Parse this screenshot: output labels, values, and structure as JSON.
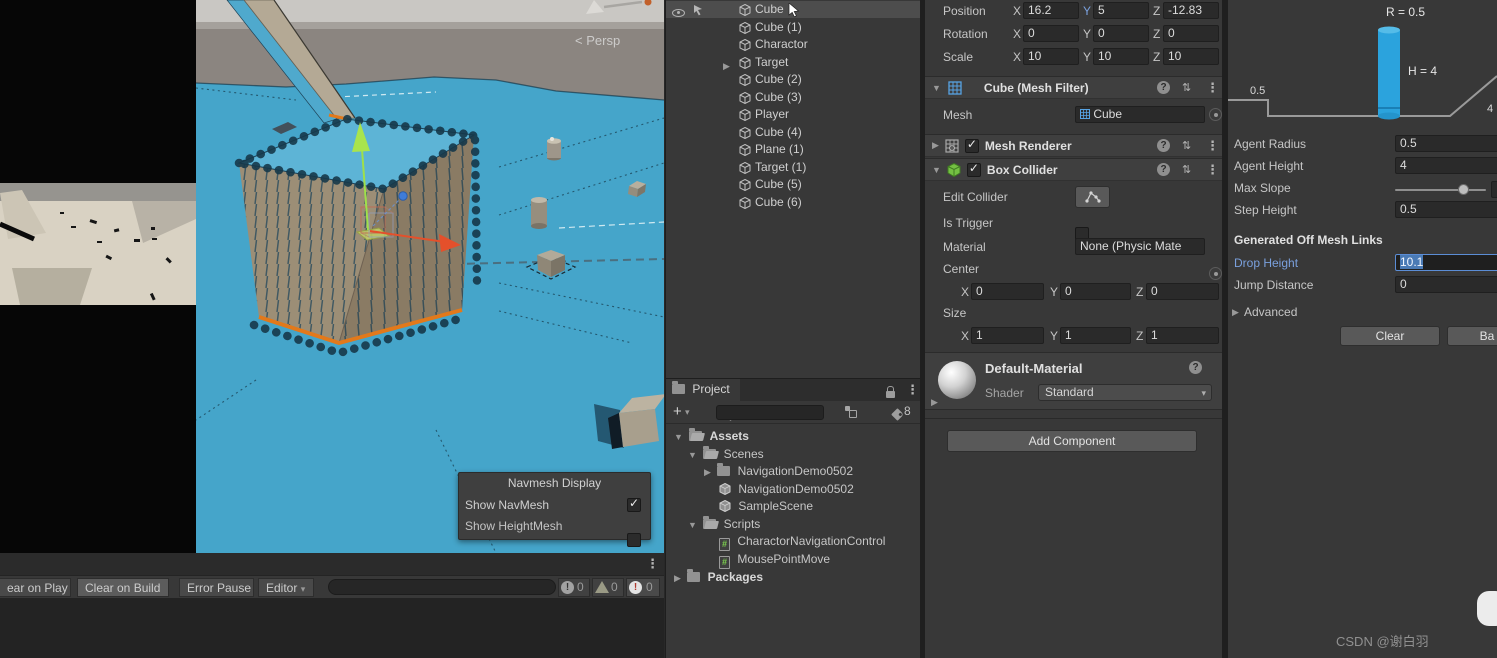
{
  "glyphs": {
    "fold_open": "▼",
    "fold_closed": "▶",
    "kebab": "⋮",
    "preset": "⇅",
    "caret_down": "▾",
    "plus": "+",
    "help": "?",
    "check": "✓",
    "bang": "!",
    "hash": "#",
    "lt": "<"
  },
  "scene": {
    "persp_label": "Persp",
    "navmesh_overlay": {
      "title": "Navmesh Display",
      "items": [
        {
          "label": "Show NavMesh",
          "checked": true
        },
        {
          "label": "Show HeightMesh",
          "checked": false
        }
      ]
    }
  },
  "hierarchy": {
    "items": [
      {
        "label": "Cube"
      },
      {
        "label": "Cube (1)"
      },
      {
        "label": "Charactor"
      },
      {
        "label": "Target"
      },
      {
        "label": "Cube (2)"
      },
      {
        "label": "Cube (3)"
      },
      {
        "label": "Player"
      },
      {
        "label": "Cube (4)"
      },
      {
        "label": "Plane (1)"
      },
      {
        "label": "Target (1)"
      },
      {
        "label": "Cube (5)"
      },
      {
        "label": "Cube (6)"
      }
    ]
  },
  "project": {
    "tab": "Project",
    "search_placeholder": "",
    "hidden_count": "8",
    "tree": [
      {
        "label": "Assets"
      },
      {
        "label": "Scenes"
      },
      {
        "label": "NavigationDemo0502"
      },
      {
        "label": "NavigationDemo0502"
      },
      {
        "label": "SampleScene"
      },
      {
        "label": "Scripts"
      },
      {
        "label": "CharactorNavigationControl"
      },
      {
        "label": "MousePointMove"
      },
      {
        "label": "Packages"
      }
    ]
  },
  "inspector": {
    "axes": {
      "x": "X",
      "y": "Y",
      "z": "Z"
    },
    "transform": {
      "position": {
        "label": "Position",
        "x": "16.2",
        "y": "5",
        "z": "-12.83"
      },
      "rotation": {
        "label": "Rotation",
        "x": "0",
        "y": "0",
        "z": "0"
      },
      "scale": {
        "label": "Scale",
        "x": "10",
        "y": "10",
        "z": "10"
      }
    },
    "mesh_filter": {
      "title": "Cube (Mesh Filter)",
      "mesh_label": "Mesh",
      "mesh_value": "Cube"
    },
    "mesh_renderer": {
      "title": "Mesh Renderer"
    },
    "box_collider": {
      "title": "Box Collider",
      "edit_collider_label": "Edit Collider",
      "is_trigger_label": "Is Trigger",
      "material_label": "Material",
      "material_value": "None (Physic Mate",
      "center_label": "Center",
      "center": {
        "x": "0",
        "y": "0",
        "z": "0"
      },
      "size_label": "Size",
      "size": {
        "x": "1",
        "y": "1",
        "z": "1"
      }
    },
    "material": {
      "title": "Default-Material",
      "shader_label": "Shader",
      "shader_value": "Standard"
    },
    "add_component": "Add Component"
  },
  "navigation": {
    "diagram": {
      "r_label": "R = 0.5",
      "h_label": "H = 4",
      "step_label": "0.5",
      "slope_label": "4"
    },
    "agent_radius": {
      "label": "Agent Radius",
      "value": "0.5"
    },
    "agent_height": {
      "label": "Agent Height",
      "value": "4"
    },
    "max_slope": {
      "label": "Max Slope"
    },
    "step_height": {
      "label": "Step Height",
      "value": "0.5"
    },
    "offmesh_title": "Generated Off Mesh Links",
    "drop_height": {
      "label": "Drop Height",
      "value": "10.1"
    },
    "jump_distance": {
      "label": "Jump Distance",
      "value": "0"
    },
    "advanced_label": "Advanced",
    "clear_button": "Clear",
    "bake_button": "Ba"
  },
  "console": {
    "clear_on_play": "ear on Play",
    "clear_on_build": "Clear on Build",
    "error_pause": "Error Pause",
    "editor": "Editor",
    "search_placeholder": "",
    "info_count": "0",
    "warning_count": "0",
    "error_count": "0"
  },
  "watermark": "CSDN @谢白羽",
  "colors": {
    "accent_blue": "#3f7cd9",
    "navmesh_blue": "#45a5ca",
    "selection_blue": "#4a7ab5",
    "orange_edge": "#e2791b",
    "label_blue": "#7aa0dd"
  }
}
